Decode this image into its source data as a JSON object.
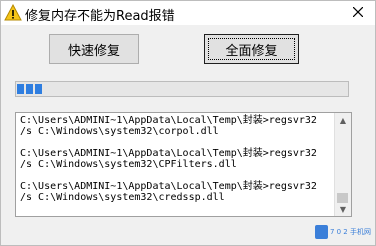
{
  "window": {
    "title": "修复内存不能为Read报错",
    "close_glyph": "✕",
    "app_icon": "warning-icon"
  },
  "buttons": {
    "quick_repair": "快速修复",
    "full_repair": "全面修复"
  },
  "progress": {
    "blocks_filled": 3,
    "fill_color": "#2f7ee0"
  },
  "log": {
    "lines": [
      "C:\\Users\\ADMINI~1\\AppData\\Local\\Temp\\封装>regsvr32",
      "/s C:\\Windows\\system32\\corpol.dll",
      "",
      "C:\\Users\\ADMINI~1\\AppData\\Local\\Temp\\封装>regsvr32",
      "/s C:\\Windows\\system32\\CPFilters.dll",
      "",
      "C:\\Users\\ADMINI~1\\AppData\\Local\\Temp\\封装>regsvr32",
      "/s C:\\Windows\\system32\\credssp.dll"
    ]
  },
  "watermark": {
    "text": "7 0 2 手机网"
  }
}
